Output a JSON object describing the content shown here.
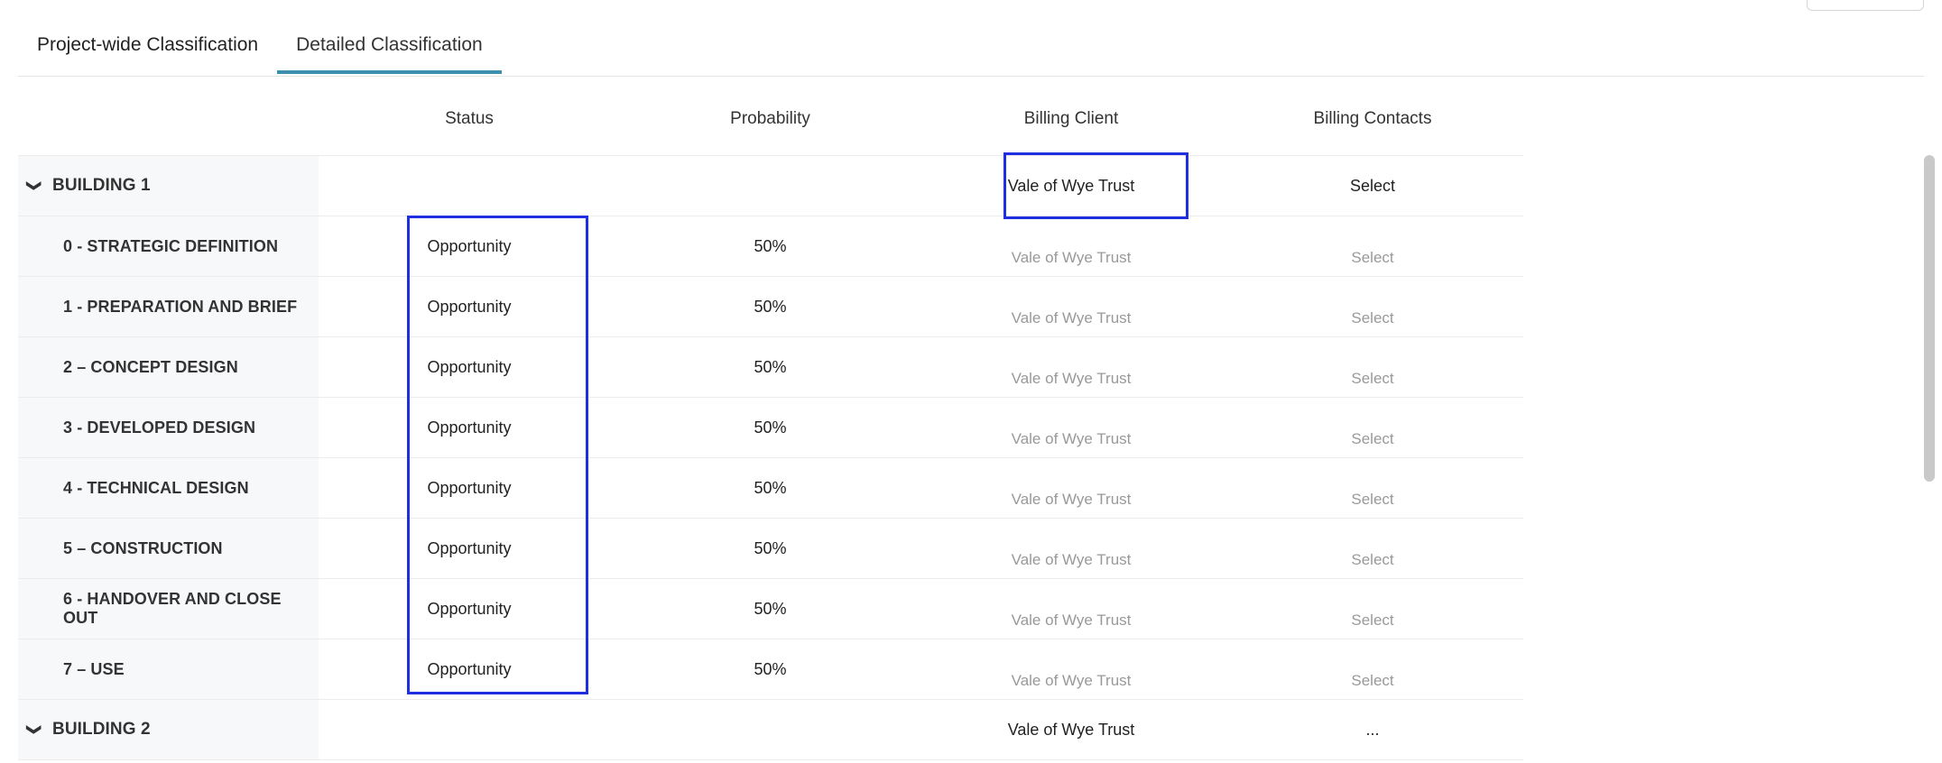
{
  "tabs": [
    {
      "label": "Project-wide Classification"
    },
    {
      "label": "Detailed Classification"
    }
  ],
  "columns": {
    "status": "Status",
    "probability": "Probability",
    "billing_client": "Billing Client",
    "billing_contacts": "Billing Contacts"
  },
  "building1": {
    "name": "BUILDING 1",
    "billing_client": "Vale of Wye Trust",
    "billing_contacts": "Select"
  },
  "stages": [
    {
      "name": "0 - STRATEGIC DEFINITION",
      "status": "Opportunity",
      "probability": "50%",
      "billing_client": "Vale of Wye Trust",
      "billing_contacts": "Select"
    },
    {
      "name": "1 - PREPARATION AND BRIEF",
      "status": "Opportunity",
      "probability": "50%",
      "billing_client": "Vale of Wye Trust",
      "billing_contacts": "Select"
    },
    {
      "name": "2 – CONCEPT DESIGN",
      "status": "Opportunity",
      "probability": "50%",
      "billing_client": "Vale of Wye Trust",
      "billing_contacts": "Select"
    },
    {
      "name": "3 - DEVELOPED DESIGN",
      "status": "Opportunity",
      "probability": "50%",
      "billing_client": "Vale of Wye Trust",
      "billing_contacts": "Select"
    },
    {
      "name": "4 - TECHNICAL DESIGN",
      "status": "Opportunity",
      "probability": "50%",
      "billing_client": "Vale of Wye Trust",
      "billing_contacts": "Select"
    },
    {
      "name": "5 – CONSTRUCTION",
      "status": "Opportunity",
      "probability": "50%",
      "billing_client": "Vale of Wye Trust",
      "billing_contacts": "Select"
    },
    {
      "name": "6 - HANDOVER AND CLOSE OUT",
      "status": "Opportunity",
      "probability": "50%",
      "billing_client": "Vale of Wye Trust",
      "billing_contacts": "Select"
    },
    {
      "name": "7 – USE",
      "status": "Opportunity",
      "probability": "50%",
      "billing_client": "Vale of Wye Trust",
      "billing_contacts": "Select"
    }
  ],
  "building2": {
    "name": "BUILDING 2",
    "billing_client": "Vale of Wye Trust",
    "billing_contacts": "..."
  },
  "icons": {
    "expand": "chevron-down-icon"
  },
  "colors": {
    "accent": "#3d8fb0",
    "highlight": "#1f2ee0"
  }
}
